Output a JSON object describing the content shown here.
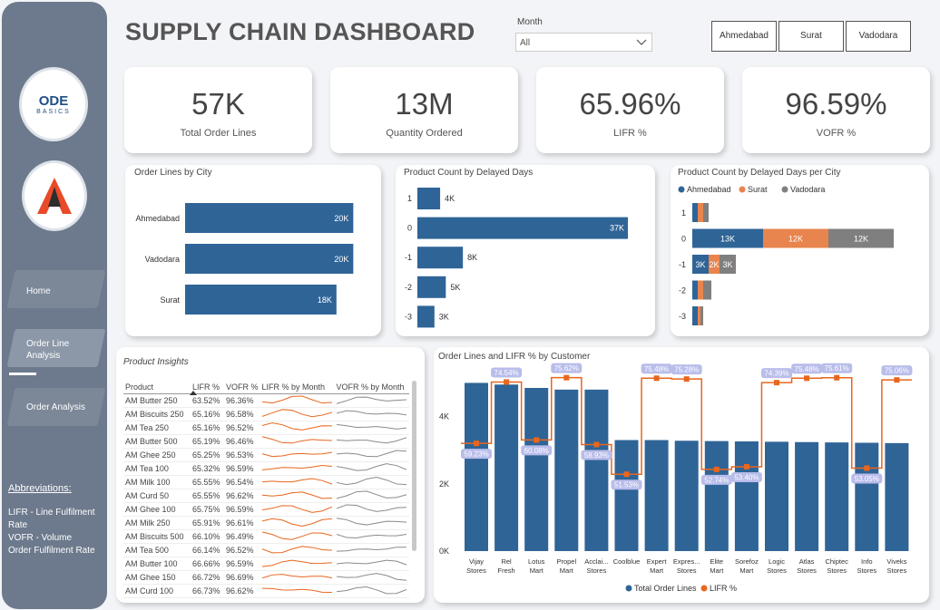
{
  "title": "SUPPLY CHAIN DASHBOARD",
  "month": {
    "label": "Month",
    "value": "All"
  },
  "cities": [
    "Ahmedabad",
    "Surat",
    "Vadodara"
  ],
  "kpis": [
    {
      "value": "57K",
      "label": "Total Order Lines"
    },
    {
      "value": "13M",
      "label": "Quantity Ordered"
    },
    {
      "value": "65.96%",
      "label": "LIFR %"
    },
    {
      "value": "96.59%",
      "label": "VOFR %"
    }
  ],
  "sidebar": {
    "nav": [
      "Home",
      "Order Line Analysis",
      "Order Analysis"
    ],
    "abbr_title": "Abbreviations:",
    "abbr_lines": [
      "LIFR - Line Fulfilment",
      "Rate",
      "VOFR - Volume",
      "Order Fulfilment Rate"
    ],
    "logo1_main": "ODE",
    "logo1_sub": "BASICS"
  },
  "colors": {
    "bar": "#2f6497",
    "orange": "#e8844d",
    "grey": "#7f7f7f",
    "accent_line": "#e8661e"
  },
  "order_lines_by_city": {
    "title": "Order Lines by City",
    "chart_data": {
      "type": "bar",
      "categories": [
        "Ahmedabad",
        "Vadodara",
        "Surat"
      ],
      "values": [
        20,
        20,
        18
      ],
      "labels": [
        "20K",
        "20K",
        "18K"
      ]
    }
  },
  "delayed": {
    "title": "Product Count by Delayed Days",
    "chart_data": {
      "type": "bar",
      "categories": [
        "1",
        "0",
        "-1",
        "-2",
        "-3"
      ],
      "values": [
        4,
        37,
        8,
        5,
        3
      ],
      "labels": [
        "4K",
        "37K",
        "8K",
        "5K",
        "3K"
      ]
    }
  },
  "delayed_city": {
    "title": "Product Count by Delayed Days per City",
    "chart_data": {
      "type": "bar",
      "categories": [
        "1",
        "0",
        "-1",
        "-2",
        "-3"
      ],
      "series": [
        {
          "name": "Ahmedabad",
          "values": [
            1,
            13,
            3,
            1,
            1
          ],
          "labels": [
            "",
            "13K",
            "3K",
            "",
            ""
          ]
        },
        {
          "name": "Surat",
          "values": [
            1,
            12,
            2,
            1,
            0.5
          ],
          "labels": [
            "",
            "12K",
            "2K",
            "",
            ""
          ]
        },
        {
          "name": "Vadodara",
          "values": [
            1,
            12,
            3,
            1.5,
            0.5
          ],
          "labels": [
            "",
            "12K",
            "3K",
            "",
            ""
          ]
        }
      ]
    }
  },
  "insights": {
    "title": "Product Insights",
    "headers": [
      "Product",
      "LIFR %",
      "VOFR %",
      "LIFR % by Month",
      "VOFR % by Month"
    ],
    "rows": [
      [
        "AM Butter 250",
        "63.52%",
        "96.36%"
      ],
      [
        "AM Biscuits 250",
        "65.16%",
        "96.58%"
      ],
      [
        "AM Tea 250",
        "65.16%",
        "96.52%"
      ],
      [
        "AM Butter 500",
        "65.19%",
        "96.46%"
      ],
      [
        "AM Ghee 250",
        "65.25%",
        "96.53%"
      ],
      [
        "AM Tea 100",
        "65.32%",
        "96.59%"
      ],
      [
        "AM Milk 100",
        "65.55%",
        "96.54%"
      ],
      [
        "AM Curd 50",
        "65.55%",
        "96.62%"
      ],
      [
        "AM Ghee 100",
        "65.75%",
        "96.59%"
      ],
      [
        "AM Milk 250",
        "65.91%",
        "96.61%"
      ],
      [
        "AM Biscuits 500",
        "66.10%",
        "96.49%"
      ],
      [
        "AM Tea 500",
        "66.14%",
        "96.52%"
      ],
      [
        "AM Butter 100",
        "66.66%",
        "96.59%"
      ],
      [
        "AM Ghee 150",
        "66.72%",
        "96.69%"
      ],
      [
        "AM Curd 100",
        "66.73%",
        "96.62%"
      ]
    ]
  },
  "customers": {
    "title": "Order Lines and LIFR % by Customer",
    "legend": [
      "Total Order Lines",
      "LIFR %"
    ],
    "yticks": [
      "4K",
      "2K",
      "0K"
    ],
    "chart_data": {
      "type": "bar",
      "categories": [
        "Vijay Stores",
        "Rel Fresh",
        "Lotus Mart",
        "Propel Mart",
        "Acclai... Stores",
        "Coolblue",
        "Expert Mart",
        "Expres... Stores",
        "Elite Mart",
        "Sorefoz Mart",
        "Logic Stores",
        "Atlas Stores",
        "Chiptec Stores",
        "Info Stores",
        "Viveks Stores"
      ],
      "values": [
        5000,
        4950,
        4850,
        4800,
        4800,
        3300,
        3300,
        3280,
        3270,
        3260,
        3250,
        3240,
        3230,
        3220,
        3210
      ],
      "lifr": [
        59.23,
        74.54,
        60.08,
        75.62,
        58.93,
        51.53,
        75.48,
        75.28,
        52.74,
        53.4,
        74.39,
        75.48,
        75.61,
        53.05,
        75.06
      ],
      "lifr_labels": [
        "59.23%",
        "74.54%",
        "60.08%",
        "75.62%",
        "58.93%",
        "51.53%",
        "75.48%",
        "75.28%",
        "52.74%",
        "53.40%",
        "74.39%",
        "75.48%",
        "75.61%",
        "53.05%",
        "75.06%"
      ],
      "series": [
        {
          "name": "Total Order Lines"
        },
        {
          "name": "LIFR %"
        }
      ],
      "ylim": [
        0,
        5200
      ]
    }
  }
}
